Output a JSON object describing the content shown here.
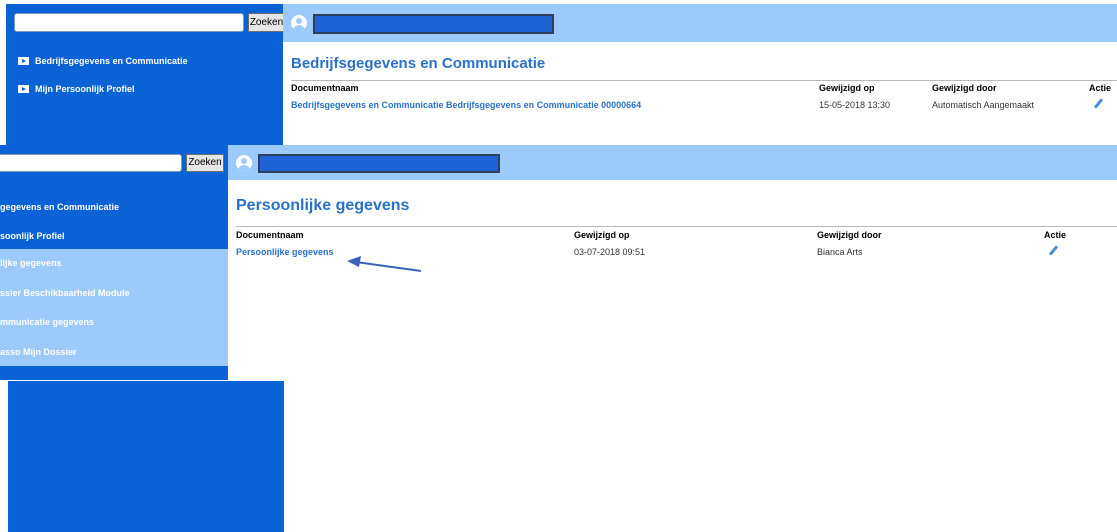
{
  "back": {
    "search": {
      "placeholder": "",
      "button": "Zoeken"
    },
    "sidebar": {
      "items": [
        {
          "label": "Bedrijfsgegevens en Communicatie"
        },
        {
          "label": "Mijn Persoonlijk Profiel"
        }
      ]
    },
    "page_title": "Bedrijfsgegevens en Communicatie",
    "table": {
      "headers": {
        "name": "Documentnaam",
        "modified_on": "Gewijzigd op",
        "modified_by": "Gewijzigd door",
        "action": "Actie"
      },
      "rows": [
        {
          "name": "Bedrijfsgegevens en Communicatie Bedrijfsgegevens en Communicatie 00000664",
          "modified_on": "15-05-2018 13:30",
          "modified_by": "Automatisch Aangemaakt",
          "action_icon": "pencil-icon"
        }
      ]
    }
  },
  "front": {
    "search": {
      "placeholder": "",
      "button": "Zoeken"
    },
    "sidebar": {
      "items": [
        {
          "label": "gegevens en Communicatie"
        },
        {
          "label": "soonlijk Profiel"
        },
        {
          "label": "lijke gegevens"
        },
        {
          "label": "ssier Beschikbaarheid Module"
        },
        {
          "label": "mmunicatie gegevens"
        },
        {
          "label": "asso Mijn Dossier"
        }
      ]
    },
    "page_title": "Persoonlijke gegevens",
    "table": {
      "headers": {
        "name": "Documentnaam",
        "modified_on": "Gewijzigd op",
        "modified_by": "Gewijzigd door",
        "action": "Actie"
      },
      "rows": [
        {
          "name": "Persoonlijke gegevens",
          "modified_on": "03-07-2018 09:51",
          "modified_by": "Bianca Arts",
          "action_icon": "pencil-icon"
        }
      ]
    }
  },
  "colors": {
    "sidebar_blue": "#0a63d6",
    "light_blue": "#9ccbfb",
    "title_blue": "#2a72c8",
    "arrow": "#3a62b8"
  }
}
